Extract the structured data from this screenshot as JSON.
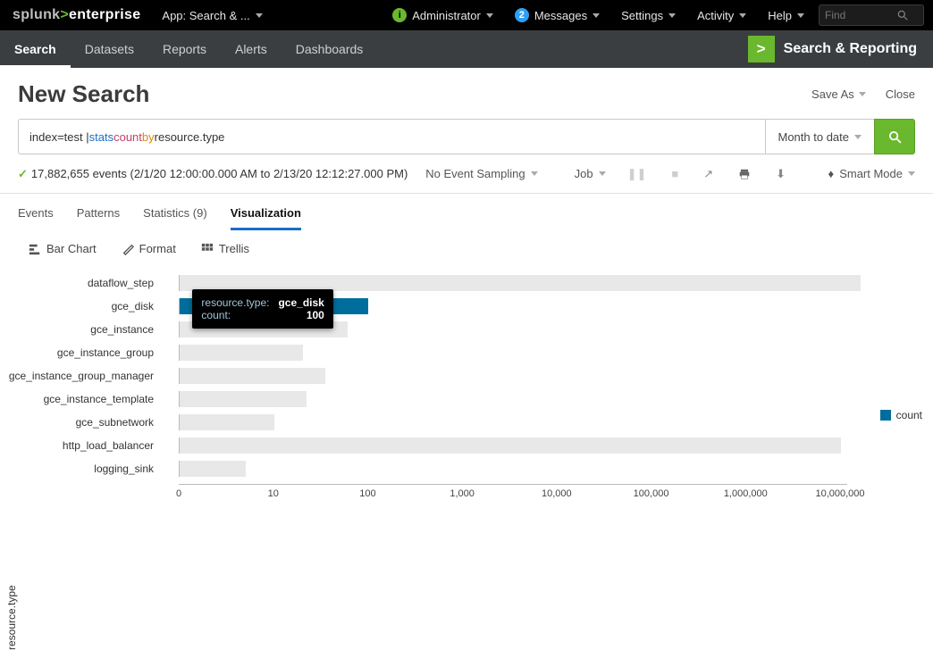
{
  "brand": {
    "pre": "splunk",
    "sep": ">",
    "post": "enterprise"
  },
  "app_switcher": "App: Search & ...",
  "topmenu": {
    "admin": "Administrator",
    "messages": "Messages",
    "messages_badge": "2",
    "settings": "Settings",
    "activity": "Activity",
    "help": "Help",
    "find_placeholder": "Find"
  },
  "nav": {
    "items": [
      "Search",
      "Datasets",
      "Reports",
      "Alerts",
      "Dashboards"
    ],
    "active": 0,
    "sr": "Search & Reporting",
    "sr_glyph": ">"
  },
  "page": {
    "title": "New Search",
    "save_as": "Save As",
    "close": "Close"
  },
  "search": {
    "tokens": [
      {
        "t": "index=test | ",
        "c": ""
      },
      {
        "t": "stats ",
        "c": "kw"
      },
      {
        "t": "count ",
        "c": "fn"
      },
      {
        "t": "by ",
        "c": "op"
      },
      {
        "t": "resource.type",
        "c": ""
      }
    ],
    "time_range": "Month to date"
  },
  "info": {
    "events": "17,882,655 events (2/1/20 12:00:00.000 AM to 2/13/20 12:12:27.000 PM)",
    "sampling": "No Event Sampling",
    "job": "Job",
    "smart": "Smart Mode"
  },
  "res_tabs": [
    "Events",
    "Patterns",
    "Statistics (9)",
    "Visualization"
  ],
  "res_tabs_active": 3,
  "viz_tools": {
    "type": "Bar Chart",
    "format": "Format",
    "trellis": "Trellis"
  },
  "legend": "count",
  "axis_label": "resource.type",
  "tooltip": {
    "k1": "resource.type:",
    "v1": "gce_disk",
    "k2": "count:",
    "v2": "100"
  },
  "chart_data": {
    "type": "bar",
    "orientation": "horizontal",
    "xscale": "log",
    "xlabel": "",
    "ylabel": "resource.type",
    "xticks": [
      0,
      10,
      100,
      1000,
      10000,
      100000,
      1000000,
      10000000
    ],
    "xtick_labels": [
      "0",
      "10",
      "100",
      "1,000",
      "10,000",
      "100,000",
      "1,000,000",
      "10,000,000"
    ],
    "series_name": "count",
    "highlighted": "gce_disk",
    "categories": [
      "dataflow_step",
      "gce_disk",
      "gce_instance",
      "gce_instance_group",
      "gce_instance_group_manager",
      "gce_instance_template",
      "gce_subnetwork",
      "http_load_balancer",
      "logging_sink"
    ],
    "values": [
      16000000,
      100,
      60,
      20,
      35,
      22,
      10,
      10000000,
      5
    ]
  }
}
